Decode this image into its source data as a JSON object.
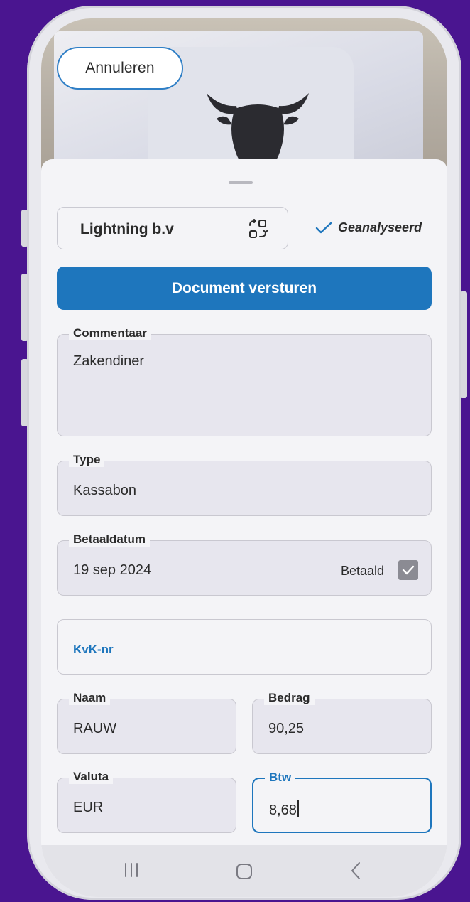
{
  "header": {
    "cancel_label": "Annuleren"
  },
  "company": {
    "name": "Lightning b.v",
    "switch_icon": "switch-company-icon"
  },
  "status": {
    "analysed_label": "Geanalyseerd"
  },
  "actions": {
    "send_label": "Document versturen"
  },
  "form": {
    "comment": {
      "label": "Commentaar",
      "value": "Zakendiner"
    },
    "type": {
      "label": "Type",
      "value": "Kassabon"
    },
    "payment_date": {
      "label": "Betaaldatum",
      "value": "19 sep 2024",
      "paid_label": "Betaald",
      "paid": true
    },
    "kvk": {
      "placeholder": "KvK-nr"
    },
    "name": {
      "label": "Naam",
      "value": "RAUW"
    },
    "amount": {
      "label": "Bedrag",
      "value": "90,25"
    },
    "currency": {
      "label": "Valuta",
      "value": "EUR"
    },
    "vat": {
      "label": "Btw",
      "value": "8,68"
    }
  },
  "colors": {
    "background": "#4a1590",
    "accent": "#1e76bd"
  }
}
